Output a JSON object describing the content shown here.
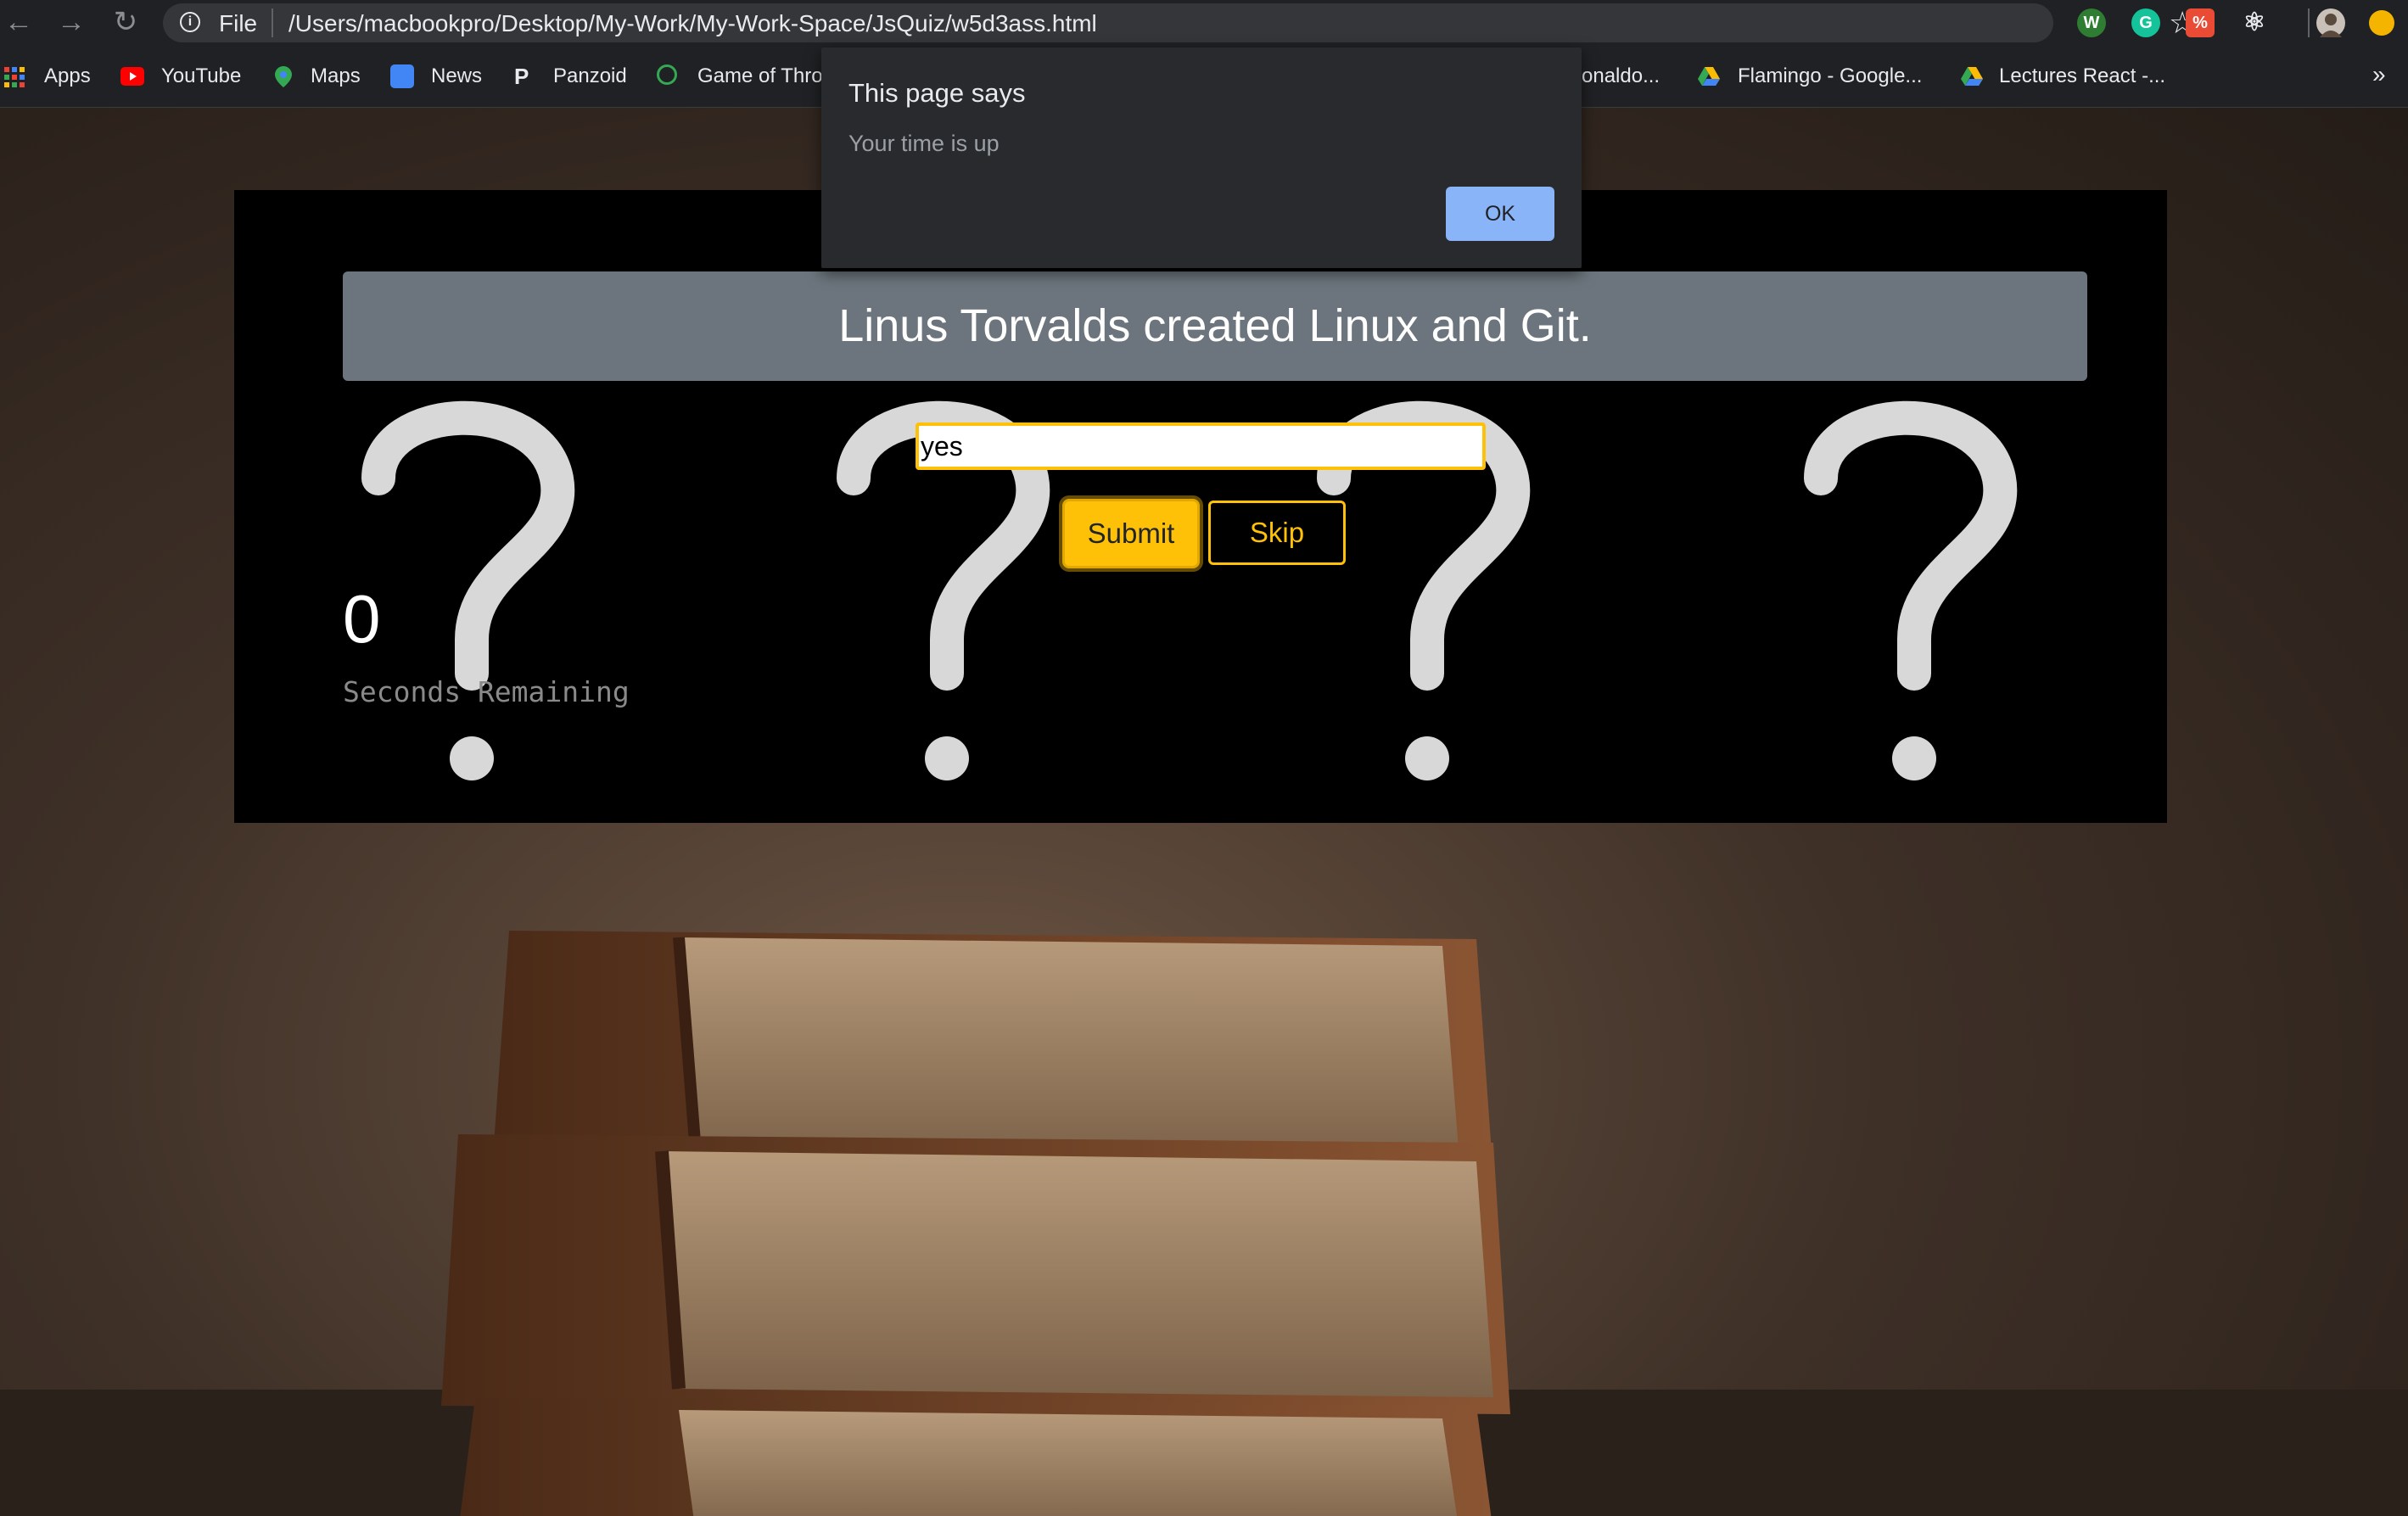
{
  "browser": {
    "scheme_label": "File",
    "url": "/Users/macbookpro/Desktop/My-Work/My-Work-Space/JsQuiz/w5d3ass.html",
    "bookmarks": [
      {
        "label": "Apps"
      },
      {
        "label": "YouTube"
      },
      {
        "label": "Maps"
      },
      {
        "label": "News"
      },
      {
        "label": "Panzoid"
      },
      {
        "label": "Game of Thro"
      },
      {
        "label": "onaldo..."
      },
      {
        "label": "Flamingo - Google..."
      },
      {
        "label": "Lectures React -..."
      }
    ],
    "overflow_chevron": "»"
  },
  "quiz": {
    "question": "Linus Torvalds created Linux and Git.",
    "answer_value": "yes",
    "submit_label": "Submit",
    "skip_label": "Skip",
    "timer_value": "0",
    "timer_label": "Seconds Remaining"
  },
  "dialog": {
    "title": "This page says",
    "message": "Your time is up",
    "ok_label": "OK"
  },
  "colors": {
    "accent": "#ffc107",
    "question_bar": "#6c757d",
    "dialog_button": "#8ab4f8"
  },
  "icons": {
    "back": "arrow-left-icon",
    "forward": "arrow-right-icon",
    "reload": "reload-icon",
    "info": "info-icon",
    "bookmark_star": "star-icon"
  }
}
